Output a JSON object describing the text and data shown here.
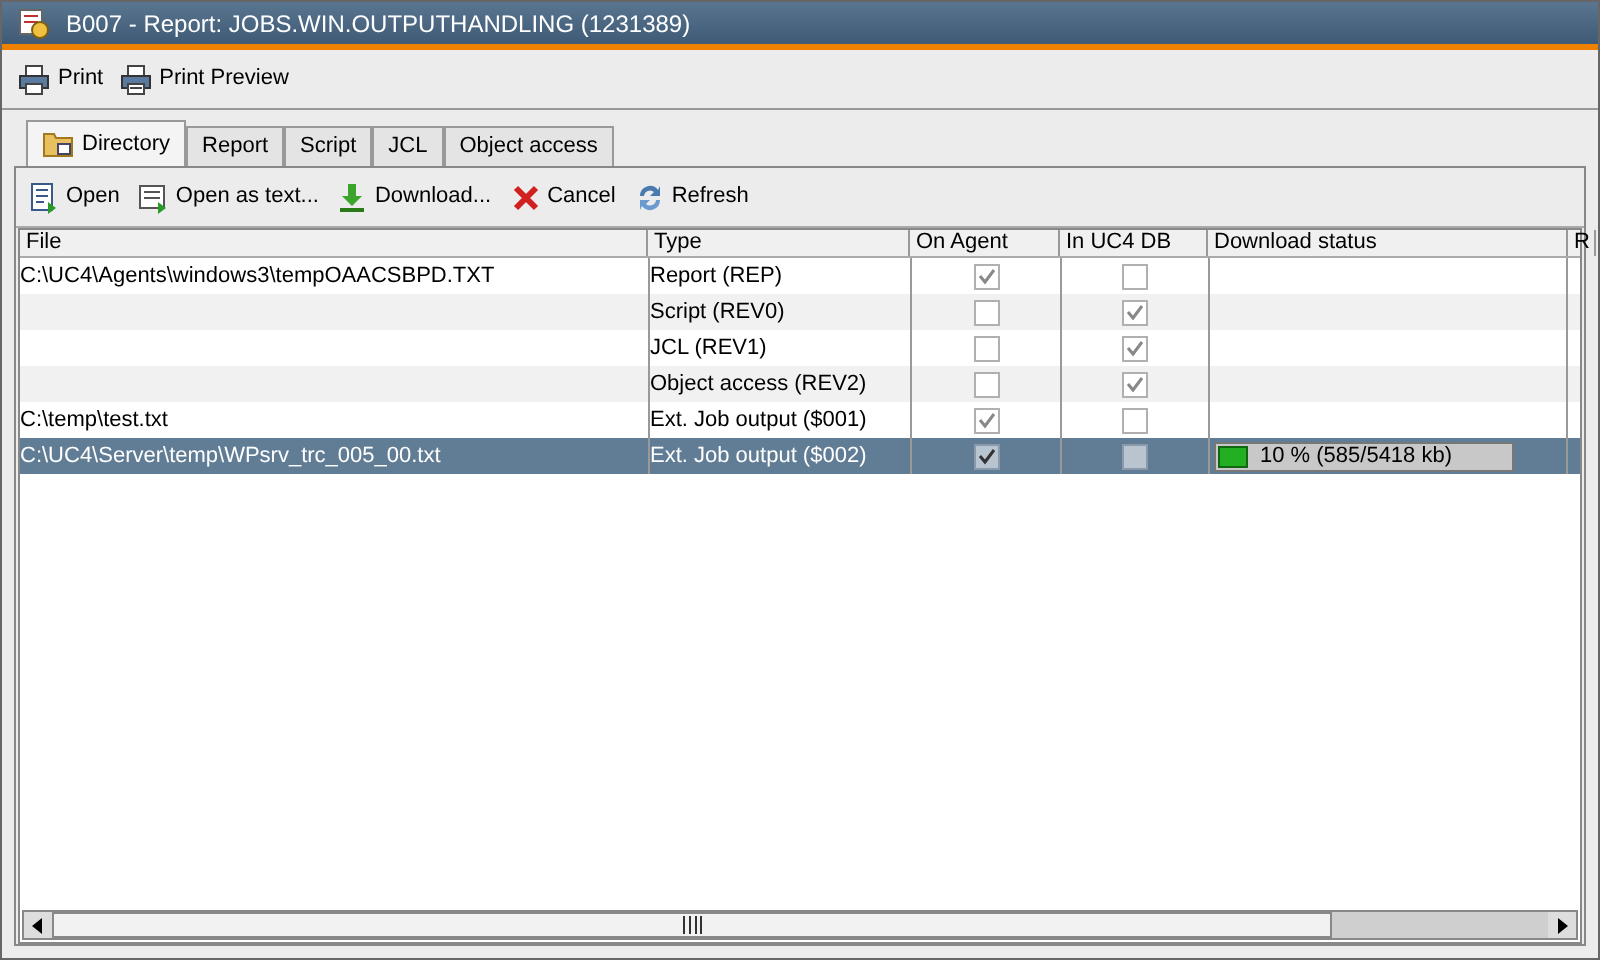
{
  "window": {
    "title": "B007 - Report: JOBS.WIN.OUTPUTHANDLING (1231389)"
  },
  "toolbar": [
    "Print",
    "Print Preview"
  ],
  "tabs": [
    {
      "label": "Directory",
      "selected": true
    },
    {
      "label": "Report",
      "selected": false
    },
    {
      "label": "Script",
      "selected": false
    },
    {
      "label": "JCL",
      "selected": false
    },
    {
      "label": "Object access",
      "selected": false
    }
  ],
  "actions": [
    {
      "label": "Open",
      "kind": "open"
    },
    {
      "label": "Open as text...",
      "kind": "text"
    },
    {
      "label": "Download...",
      "kind": "download"
    },
    {
      "label": "Cancel",
      "kind": "cancel"
    },
    {
      "label": "Refresh",
      "kind": "refresh"
    }
  ],
  "table": {
    "columns": [
      "File",
      "Type",
      "On Agent",
      "In UC4 DB",
      "Download status",
      "R"
    ],
    "rows": [
      {
        "file": "C:\\UC4\\Agents\\windows3\\tempOAACSBPD.TXT",
        "type": "Report (REP)",
        "on_agent": true,
        "in_db": false,
        "selected": false
      },
      {
        "type": "Script (REV0)",
        "on_agent": false,
        "in_db": true,
        "selected": false
      },
      {
        "type": "JCL (REV1)",
        "on_agent": false,
        "in_db": true,
        "selected": false
      },
      {
        "type": "Object access (REV2)",
        "on_agent": false,
        "in_db": true,
        "selected": false
      },
      {
        "file": "C:\\temp\\test.txt",
        "type": "Ext. Job output ($001)",
        "on_agent": true,
        "in_db": false,
        "selected": false
      },
      {
        "file": "C:\\UC4\\Server\\temp\\WPsrv_trc_005_00.txt",
        "type": "Ext. Job output ($002)",
        "on_agent": true,
        "in_db": false,
        "selected": true,
        "download": {
          "level": 0.1,
          "reading": "10 %  (585/5418 kb)"
        }
      }
    ]
  }
}
